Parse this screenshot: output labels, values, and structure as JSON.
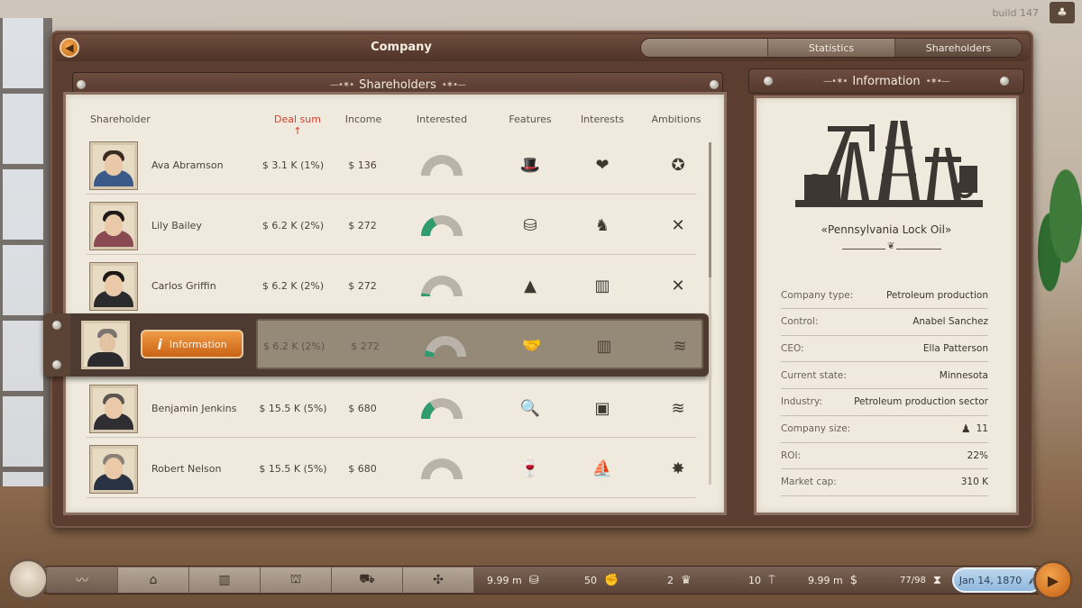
{
  "build": "build 147",
  "window": {
    "title": "Company",
    "tabs": [
      "Statistics",
      "Shareholders"
    ]
  },
  "shareholders_panel": {
    "title": "Shareholders",
    "columns": {
      "shareholder": "Shareholder",
      "deal_sum": "Deal sum ↑",
      "income": "Income",
      "interested": "Interested",
      "features": "Features",
      "interests": "Interests",
      "ambitions": "Ambitions"
    },
    "rows": [
      {
        "name": "Ava Abramson",
        "deal": "$ 3.1 K (1%)",
        "income": "$ 136",
        "interest_level": 0.0,
        "feature_icon": "top-hat-icon",
        "feature": "🎩",
        "interest_icon": "heart-hands-icon",
        "interest": "❤",
        "ambition_icon": "star-badge-icon",
        "ambition": "✪",
        "hair": "#3a2c22",
        "coat": "#3b5a8a"
      },
      {
        "name": "Lily Bailey",
        "deal": "$ 6.2 K (2%)",
        "income": "$ 272",
        "interest_level": 0.35,
        "feature_icon": "coins-icon",
        "feature": "⛁",
        "interest_icon": "horse-icon",
        "interest": "♞",
        "ambition_icon": "crossed-tools-icon",
        "ambition": "✕",
        "hair": "#1f1a17",
        "coat": "#8a4a52"
      },
      {
        "name": "Carlos Griffin",
        "deal": "$ 6.2 K (2%)",
        "income": "$ 272",
        "interest_level": 0.05,
        "feature_icon": "mountains-icon",
        "feature": "▲",
        "interest_icon": "columns-icon",
        "interest": "▥",
        "ambition_icon": "crossed-tools-icon",
        "ambition": "✕",
        "hair": "#1a1715",
        "coat": "#2b2b2e"
      }
    ],
    "selected_row": {
      "info_label": "Information",
      "deal": "$ 6.2 K (2%)",
      "income": "$ 272",
      "interest_level": 0.1,
      "feature": "🤝",
      "interest": "▥",
      "ambition": "≋"
    },
    "rows_after": [
      {
        "name": "Benjamin Jenkins",
        "deal": "$ 15.5 K (5%)",
        "income": "$ 680",
        "interest_level": 0.3,
        "feature_icon": "magnifier-icon",
        "feature": "🔍",
        "interest_icon": "framed-picture-icon",
        "interest": "▣",
        "ambition_icon": "wheat-icon",
        "ambition": "≋",
        "hair": "#5a5550",
        "coat": "#2e2e33"
      },
      {
        "name": "Robert Nelson",
        "deal": "$ 15.5 K (5%)",
        "income": "$ 680",
        "interest_level": 0.0,
        "feature_icon": "wine-icon",
        "feature": "🍷",
        "interest_icon": "sailboat-icon",
        "interest": "⛵",
        "ambition_icon": "fireworks-icon",
        "ambition": "✸",
        "hair": "#8a8178",
        "coat": "#2a3344"
      }
    ]
  },
  "info_panel": {
    "title": "Information",
    "company_name": "«Pennsylvania Lock Oil»",
    "fields": [
      {
        "key": "Company type:",
        "value": "Petroleum production"
      },
      {
        "key": "Control:",
        "value": "Anabel Sanchez"
      },
      {
        "key": "CEO:",
        "value": "Ella Patterson"
      },
      {
        "key": "Current state:",
        "value": "Minnesota"
      },
      {
        "key": "Industry:",
        "value": "Petroleum production sector"
      },
      {
        "key": "Company size:",
        "value": "11"
      },
      {
        "key": "ROI:",
        "value": "22%"
      },
      {
        "key": "Market cap:",
        "value": "310 K"
      }
    ]
  },
  "bottom_bar": {
    "money": "9.99 m",
    "workers": "50",
    "crowns": "2",
    "resource": "10",
    "cash": "9.99 m",
    "hourglass": "77/98",
    "date": "Jan 14, 1870"
  },
  "colors": {
    "accent_orange": "#e08a35",
    "sorted_red": "#d5402f",
    "gauge_green": "#2f9b6e",
    "gauge_gray": "#b9b3a9"
  }
}
